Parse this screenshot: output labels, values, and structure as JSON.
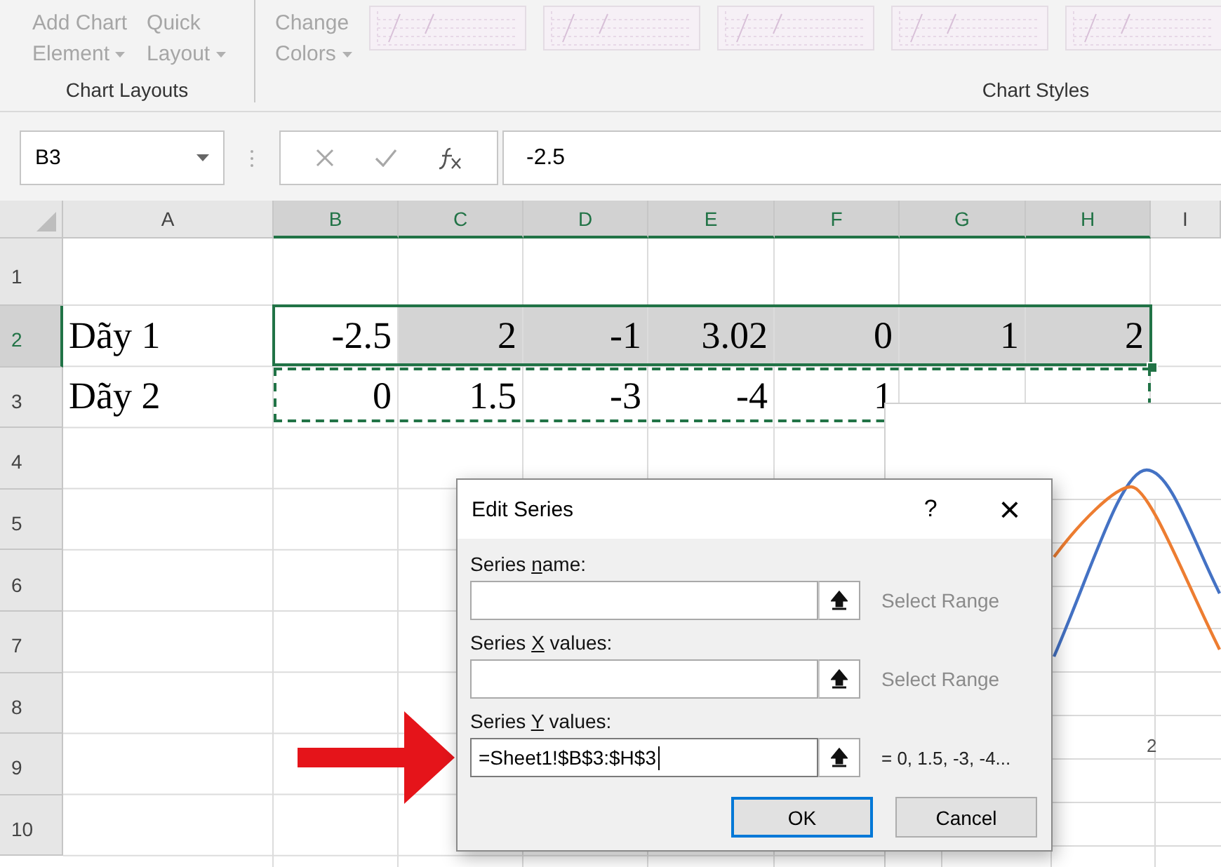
{
  "ribbon": {
    "groups": [
      {
        "kind": "buttons",
        "label": "Chart Layouts",
        "buttons": [
          {
            "lines": [
              "Add Chart",
              "Element"
            ],
            "disabled": true
          },
          {
            "lines": [
              "Quick",
              "Layout"
            ],
            "disabled": true
          }
        ]
      },
      {
        "kind": "gallery",
        "label": "Chart Styles",
        "buttons": [
          {
            "lines": [
              "Change",
              "Colors"
            ],
            "disabled": true
          }
        ]
      }
    ]
  },
  "formula_bar": {
    "name_box": "B3",
    "formula": "-2.5"
  },
  "columns": [
    {
      "label": "A",
      "selected": false
    },
    {
      "label": "B",
      "selected": true
    },
    {
      "label": "C",
      "selected": true
    },
    {
      "label": "D",
      "selected": true
    },
    {
      "label": "E",
      "selected": true
    },
    {
      "label": "F",
      "selected": true
    },
    {
      "label": "G",
      "selected": true
    },
    {
      "label": "H",
      "selected": true
    },
    {
      "label": "I",
      "selected": false
    }
  ],
  "rows": [
    {
      "number": "1",
      "selected": false,
      "copied": false
    },
    {
      "number": "2",
      "selected": true,
      "copied": false,
      "cells": [
        {
          "text": "Dãy 1",
          "kind": "label",
          "selected": false
        },
        {
          "text": "-2.5",
          "kind": "number",
          "selected": false
        },
        {
          "text": "2",
          "kind": "number",
          "selected": true
        },
        {
          "text": "-1",
          "kind": "number",
          "selected": true
        },
        {
          "text": "3.02",
          "kind": "number",
          "selected": true
        },
        {
          "text": "0",
          "kind": "number",
          "selected": true
        },
        {
          "text": "1",
          "kind": "number",
          "selected": true
        },
        {
          "text": "2",
          "kind": "number",
          "selected": true
        }
      ]
    },
    {
      "number": "3",
      "selected": false,
      "copied": true,
      "cells": [
        {
          "text": "Dãy 2",
          "kind": "label",
          "selected": false
        },
        {
          "text": "0",
          "kind": "number",
          "selected": false
        },
        {
          "text": "1.5",
          "kind": "number",
          "selected": false
        },
        {
          "text": "-3",
          "kind": "number",
          "selected": false
        },
        {
          "text": "-4",
          "kind": "number",
          "selected": false
        },
        {
          "text": "1",
          "kind": "number",
          "selected": false
        }
      ]
    },
    {
      "number": "4",
      "selected": false,
      "copied": false
    },
    {
      "number": "5",
      "selected": false,
      "copied": false
    },
    {
      "number": "6",
      "selected": false,
      "copied": false
    },
    {
      "number": "7",
      "selected": false,
      "copied": false
    },
    {
      "number": "8",
      "selected": false,
      "copied": false
    },
    {
      "number": "9",
      "selected": false,
      "copied": false
    },
    {
      "number": "10",
      "selected": false,
      "copied": false
    }
  ],
  "chart": {
    "axis_label": "2"
  },
  "dialog": {
    "title": "Edit Series",
    "help": "?",
    "close": "×",
    "fields": [
      {
        "label_before": "Series ",
        "access_key": "n",
        "label_after": "ame:",
        "hint": "Select Range",
        "focused": false
      },
      {
        "label_before": "Series ",
        "access_key": "X",
        "label_after": " values:",
        "hint": "Select Range",
        "focused": false
      },
      {
        "label_before": "Series ",
        "access_key": "Y",
        "label_after": " values:",
        "value": "=Sheet1!$B$3:$H$3",
        "result": "= 0, 1.5, -3, -4...",
        "focused": true
      }
    ],
    "buttons": [
      {
        "label": "OK",
        "default": true
      },
      {
        "label": "Cancel",
        "default": false
      }
    ]
  }
}
